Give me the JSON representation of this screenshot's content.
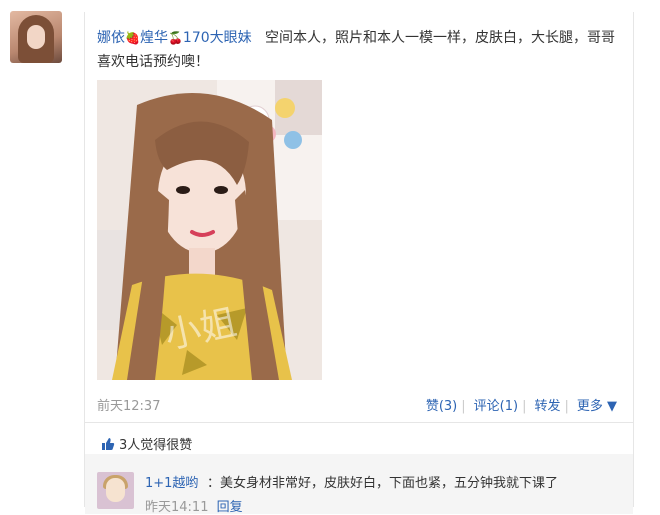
{
  "post": {
    "author": "娜依",
    "author_emoji1": "🍓",
    "author_mid": "煌华",
    "author_emoji2": "🍒",
    "author_suffix": "170大眼妹",
    "text": "空间本人，照片和本人一模一样，皮肤白，大长腿，哥哥喜欢电话预约噢！",
    "watermark": "小姐",
    "time": "前天12:37",
    "like_label": "赞(3)",
    "comment_label": "评论(1)",
    "repost_label": "转发",
    "more_label": "更多 ▼"
  },
  "likes": {
    "text": "3人觉得很赞"
  },
  "comment": {
    "name": "1+1越哟",
    "text": "：美女身材非常好，皮肤好白，下面也紧，五分钟我就下课了",
    "time": "昨天14:11",
    "reply_label": "回复"
  },
  "colors": {
    "link": "#2d64b3",
    "muted": "#999999",
    "comment_bg": "#f5f5f5"
  }
}
